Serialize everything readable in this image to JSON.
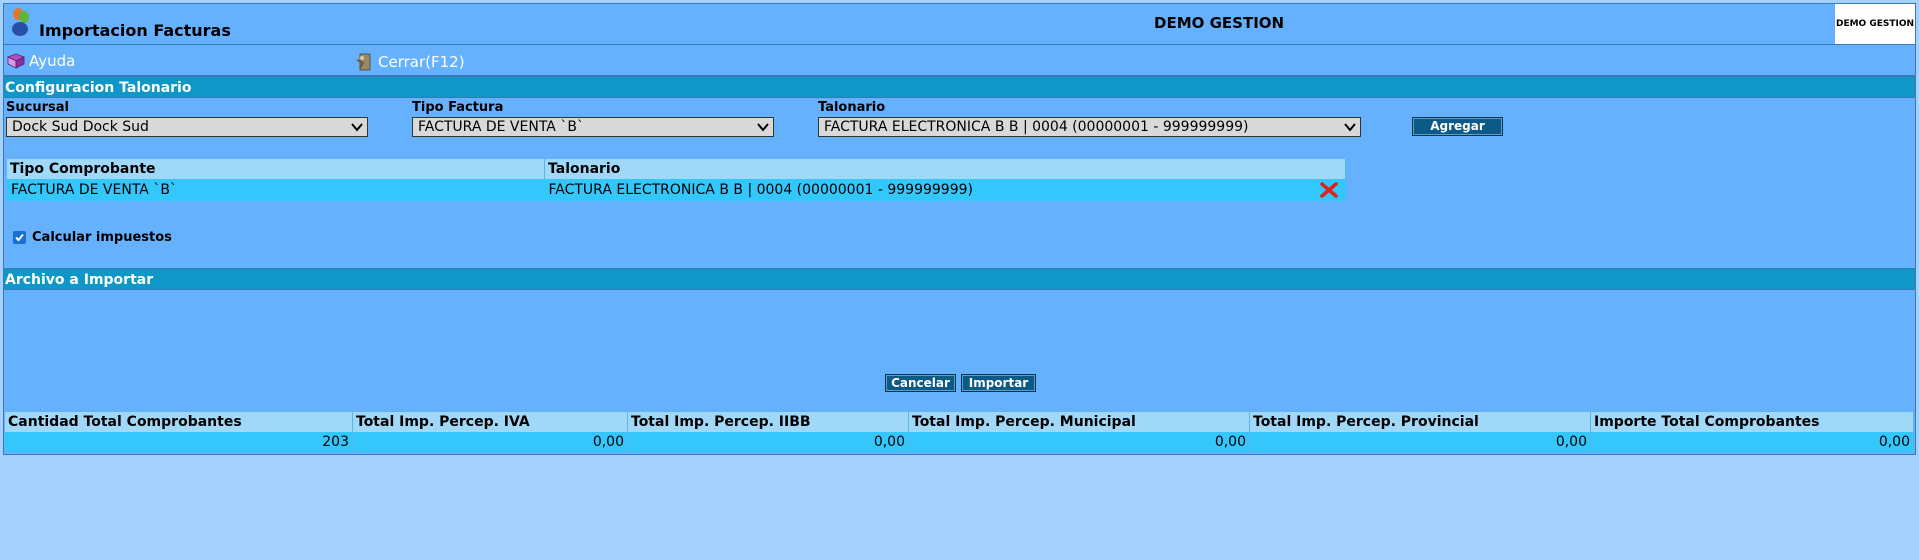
{
  "app": {
    "title": "Importacion Facturas",
    "company": "DEMO GESTION",
    "logo_text": "DEMO GESTION"
  },
  "toolbar": {
    "help_label": "Ayuda",
    "close_label": "Cerrar(F12)"
  },
  "config": {
    "header": "Configuracion Talonario",
    "sucursal_label": "Sucursal",
    "sucursal_value": "Dock Sud Dock Sud",
    "tipo_factura_label": "Tipo Factura",
    "tipo_factura_value": "FACTURA DE VENTA `B`",
    "talonario_label": "Talonario",
    "talonario_value": "FACTURA ELECTRONICA B B | 0004 (00000001 - 999999999)",
    "add_label": "Agregar",
    "table": {
      "headers": [
        "Tipo Comprobante",
        "Talonario"
      ],
      "rows": [
        [
          "FACTURA DE VENTA `B`",
          "FACTURA ELECTRONICA B B | 0004 (00000001 - 999999999)"
        ]
      ]
    },
    "calc_taxes_label": "Calcular impuestos",
    "calc_taxes_checked": true
  },
  "import": {
    "header": "Archivo a Importar",
    "cancel_label": "Cancelar",
    "import_label": "Importar"
  },
  "totals": {
    "headers": [
      "Cantidad Total Comprobantes",
      "Total Imp. Percep. IVA",
      "Total Imp. Percep. IIBB",
      "Total Imp. Percep. Municipal",
      "Total Imp. Percep. Provincial",
      "Importe Total Comprobantes"
    ],
    "values": [
      "203",
      "0,00",
      "0,00",
      "0,00",
      "0,00",
      "0,00"
    ]
  },
  "colors": {
    "background": "#a6d1fe",
    "panel": "#66b1fd",
    "section_header": "#0f97c8",
    "table_header": "#9fd8f8",
    "table_row": "#33c7fb",
    "button": "#0b5a87"
  }
}
